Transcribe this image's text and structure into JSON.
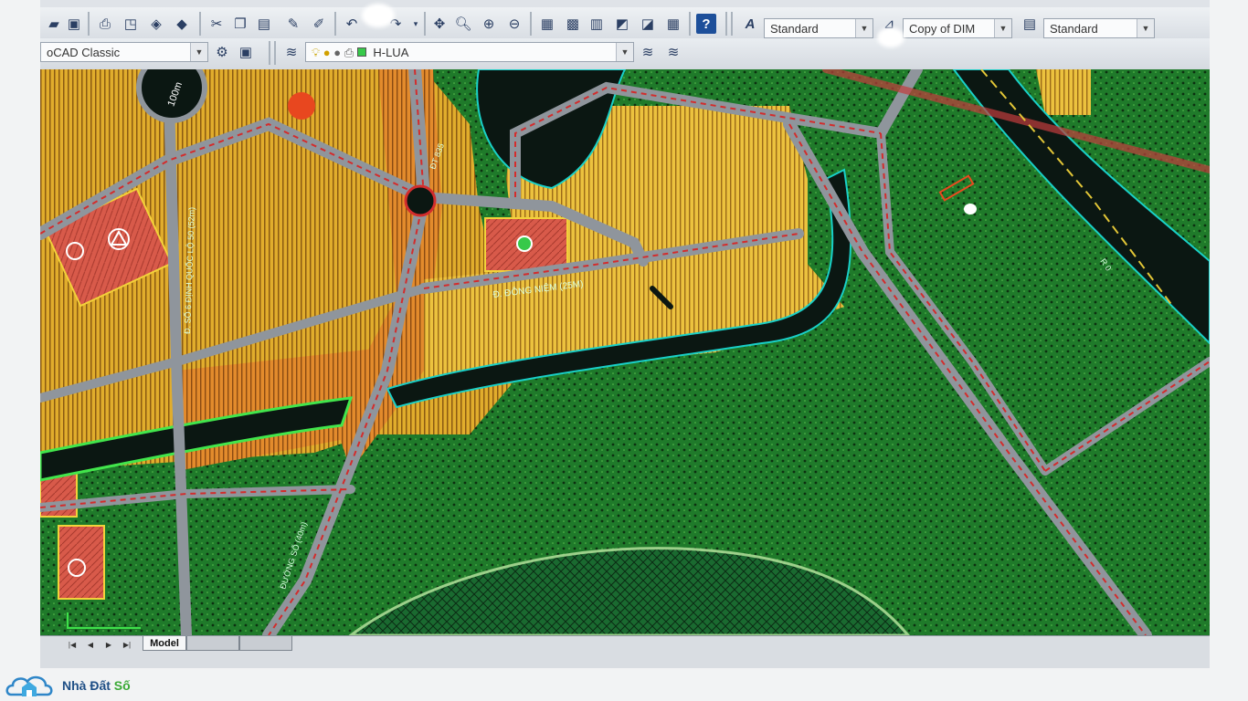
{
  "toolbar": {
    "workspace": "oCAD Classic",
    "layer_name": "H-LUA",
    "text_style": "Standard",
    "dim_style": "Copy of DIM",
    "table_style": "Standard",
    "help_icon": "question-icon"
  },
  "map": {
    "scale_label": "100m",
    "road_label_1": "Đ. ĐÔNG NIỆM (25M)",
    "road_label_2": "Đ. SỐ 6 ĐỊNH QUỐC LỘ 50 (52m)",
    "road_label_3": "ĐƯỜNG SỐ (40m)",
    "road_label_4": "ĐT 835",
    "road_label_5": "R 0",
    "colors": {
      "residential": "#e1ad2c",
      "commercial": "#dc5a49",
      "green": "#1f7d28",
      "water": "#0b1712",
      "road": "#8f959c"
    }
  },
  "tabs": {
    "model": "Model",
    "layout1": "",
    "layout2": ""
  },
  "brand": {
    "name_part1": "Nhà Đất ",
    "name_part2": "Số"
  }
}
